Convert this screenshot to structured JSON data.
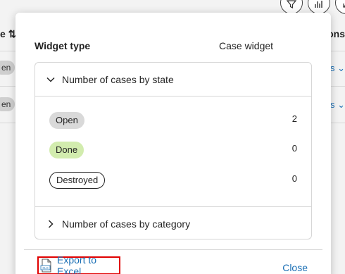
{
  "background": {
    "header_left": "e ⇅",
    "header_right": "ons",
    "rows": [
      {
        "pill": "en",
        "link": "ns ⌄"
      },
      {
        "pill": "en",
        "link": "ns ⌄"
      }
    ]
  },
  "widget": {
    "type_label": "Widget type",
    "type_value": "Case widget",
    "sections": [
      {
        "title": "Number of cases by state",
        "expanded": true,
        "items": [
          {
            "label": "Open",
            "count": "2",
            "style": "open"
          },
          {
            "label": "Done",
            "count": "0",
            "style": "done"
          },
          {
            "label": "Destroyed",
            "count": "0",
            "style": "destroyed"
          }
        ]
      },
      {
        "title": "Number of cases by category",
        "expanded": false
      }
    ]
  },
  "footer": {
    "export_label": "Export to Excel",
    "close_label": "Close"
  },
  "colors": {
    "link": "#1a6fb5",
    "highlight": "#e00000",
    "done_pill": "#d2ecae",
    "open_pill": "#d9d9d9"
  }
}
